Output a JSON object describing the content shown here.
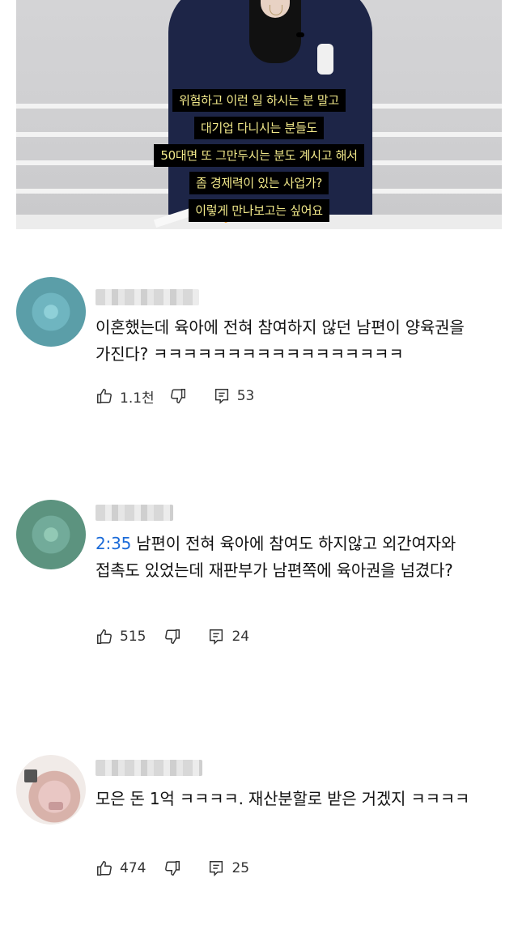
{
  "video": {
    "captions": [
      "위험하고 이런 일 하시는 분 말고",
      "대기업 다니시는 분들도",
      "50대면 또 그만두시는 분도 계시고 해서",
      "좀 경제력이 있는 사업가?",
      "이렇게 만나보고는 싶어요"
    ]
  },
  "comments": [
    {
      "timestamp": "",
      "text": "이혼했는데 육아에 전혀 참여하지 않던 남편이 양육권을 가진다? ㅋㅋㅋㅋㅋㅋㅋㅋㅋㅋㅋㅋㅋㅋㅋㅋㅋ",
      "likes": "1.1천",
      "replies": "53"
    },
    {
      "timestamp": "2:35",
      "text": "남편이 전혀 육아에 참여도 하지않고 외간여자와 접촉도 있었는데 재판부가 남편쪽에 육아권을 넘겼다?",
      "likes": "515",
      "replies": "24"
    },
    {
      "timestamp": "",
      "text": "모은 돈 1억 ㅋㅋㅋㅋ. 재산분할로 받은 거겠지 ㅋㅋㅋㅋ",
      "likes": "474",
      "replies": "25"
    }
  ],
  "icons": {
    "like": "thumbs-up-icon",
    "dislike": "thumbs-down-icon",
    "reply": "reply-icon"
  },
  "colors": {
    "timestamp_link": "#1a6ad8",
    "caption_text": "#f2e98a"
  }
}
